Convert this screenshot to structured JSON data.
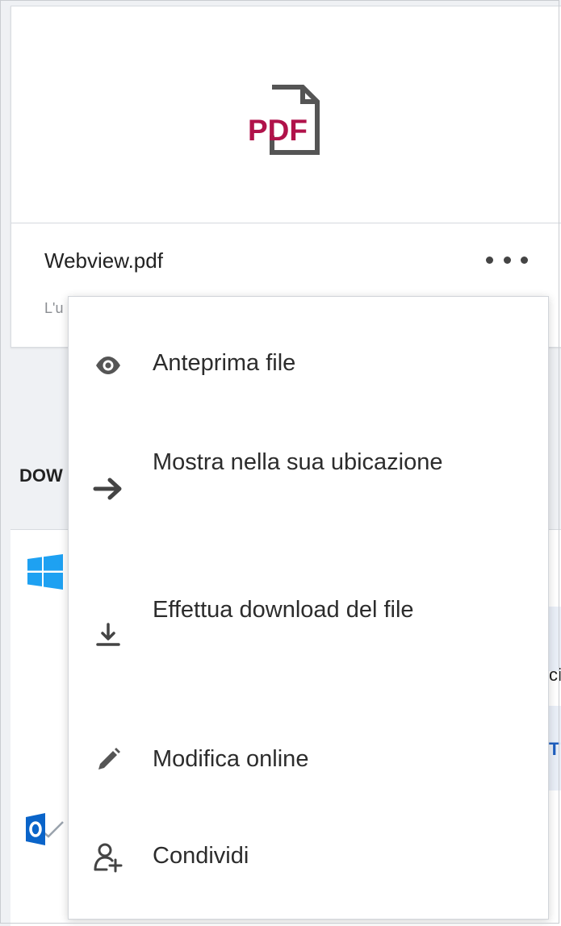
{
  "file_card": {
    "file_name": "Webview.pdf",
    "meta_text": "L'u",
    "more_icon": "more-horizontal-icon",
    "file_icon": "pdf-file-icon"
  },
  "background": {
    "section_title": "DOW",
    "peek_a": "ci",
    "peek_b": "T"
  },
  "context_menu": {
    "items": [
      {
        "label": "Anteprima file",
        "icon": "eye-icon"
      },
      {
        "label": "Mostra nella sua ubicazione",
        "icon": "arrow-right-icon"
      },
      {
        "label": "Effettua download del file",
        "icon": "download-icon"
      },
      {
        "label": "Modifica online",
        "icon": "pencil-icon"
      },
      {
        "label": "Condividi",
        "icon": "share-user-add-icon"
      }
    ]
  },
  "colors": {
    "pdf_accent": "#b0124a",
    "icon_gray": "#555555",
    "windows_blue": "#1ea1f2",
    "outlook_blue": "#0a64c9"
  }
}
